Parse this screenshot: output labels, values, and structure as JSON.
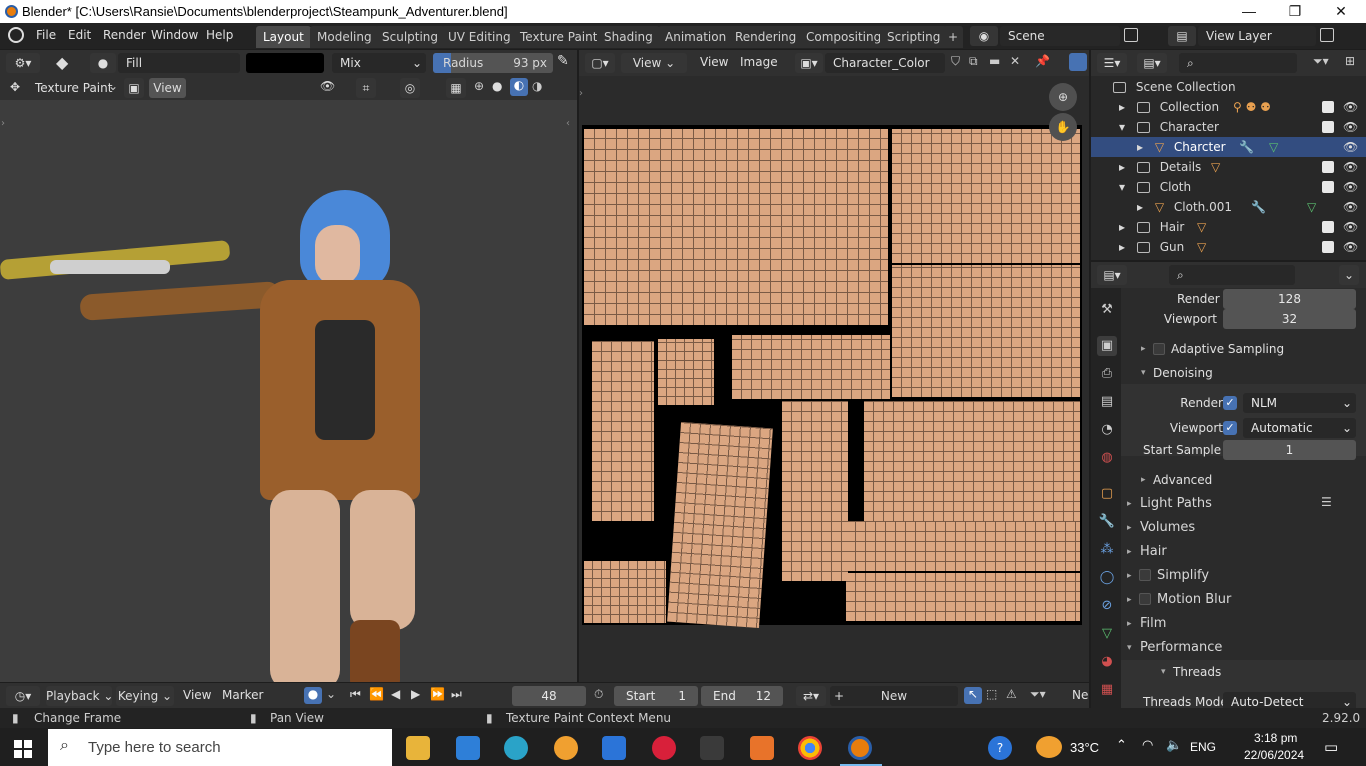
{
  "window": {
    "title": "Blender* [C:\\Users\\Ransie\\Documents\\blenderproject\\Steampunk_Adventurer.blend]",
    "minimize": "—",
    "maximize": "❐",
    "close": "✕"
  },
  "menu": [
    "File",
    "Edit",
    "Render",
    "Window",
    "Help"
  ],
  "workspaces": [
    "Layout",
    "Modeling",
    "Sculpting",
    "UV Editing",
    "Texture Paint",
    "Shading",
    "Animation",
    "Rendering",
    "Compositing",
    "Scripting"
  ],
  "active_workspace": "Layout",
  "scene": "Scene",
  "view_layer": "View Layer",
  "tool_header": {
    "brush": "Fill",
    "blend": "Mix",
    "radius_label": "Radius",
    "radius_value": "93 px"
  },
  "viewport": {
    "mode": "Texture Paint",
    "view_btn": "View"
  },
  "image_editor": {
    "view_menu": "View",
    "menu_view": "View",
    "menu_image": "Image",
    "image_name": "Character_Color"
  },
  "outliner": {
    "root": "Scene Collection",
    "rows": [
      {
        "name": "Collection",
        "expand": "▸"
      },
      {
        "name": "Character",
        "expand": "▾"
      },
      {
        "name": "Charcter",
        "expand": "▸"
      },
      {
        "name": "Details",
        "expand": "▸"
      },
      {
        "name": "Cloth",
        "expand": "▾"
      },
      {
        "name": "Cloth.001",
        "expand": "▸"
      },
      {
        "name": "Hair",
        "expand": "▸"
      },
      {
        "name": "Gun",
        "expand": "▸"
      }
    ]
  },
  "properties": {
    "render_label": "Render",
    "render_value": "128",
    "viewport_label": "Viewport",
    "viewport_value": "32",
    "adaptive": "Adaptive Sampling",
    "denoising": "Denoising",
    "den_render_label": "Render",
    "den_render_value": "NLM",
    "den_viewport_label": "Viewport",
    "den_viewport_value": "Automatic",
    "start_sample_label": "Start Sample",
    "start_sample_value": "1",
    "advanced": "Advanced",
    "sections": [
      "Light Paths",
      "Volumes",
      "Hair",
      "Simplify",
      "Motion Blur",
      "Film",
      "Performance"
    ],
    "threads": "Threads",
    "threads_mode_label": "Threads Mode",
    "threads_mode_value": "Auto-Detect"
  },
  "timeline": {
    "playback": "Playback",
    "keying": "Keying",
    "view": "View",
    "marker": "Marker",
    "frame": "48",
    "start_label": "Start",
    "start": "1",
    "end_label": "End",
    "end": "12",
    "new_label": "New",
    "ne": "Ne"
  },
  "status": {
    "change_frame": "Change Frame",
    "pan_view": "Pan View",
    "context_menu": "Texture Paint Context Menu",
    "version": "2.92.0"
  },
  "taskbar": {
    "search_placeholder": "Type here to search",
    "temperature": "33°C",
    "lang": "ENG",
    "time": "3:18 pm",
    "date": "22/06/2024"
  }
}
